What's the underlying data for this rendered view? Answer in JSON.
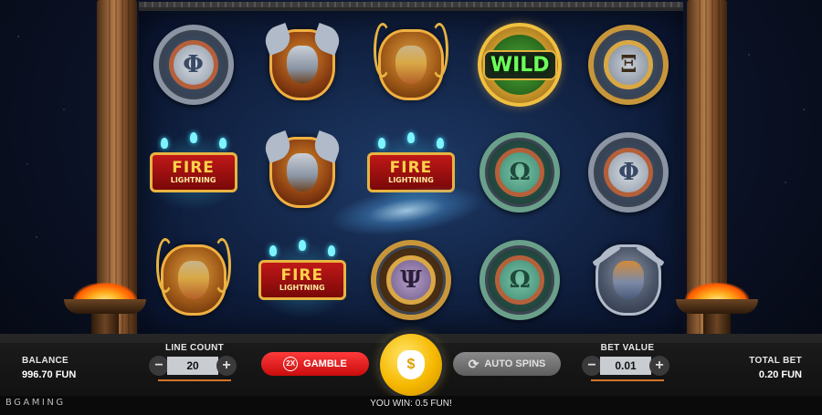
{
  "brand": "BGAMING",
  "balance": {
    "label": "BALANCE",
    "value": "996.70 FUN"
  },
  "total_bet": {
    "label": "TOTAL BET",
    "value": "0.20 FUN"
  },
  "line_count": {
    "label": "LINE COUNT",
    "value": "20",
    "minus": "−",
    "plus": "+"
  },
  "bet_value": {
    "label": "BET VALUE",
    "value": "0.01",
    "minus": "−",
    "plus": "+"
  },
  "gamble": {
    "badge": "2X",
    "label": "GAMBLE"
  },
  "spin": {
    "icon": "money-bag-icon",
    "glyph": "$"
  },
  "auto_spins": {
    "icon": "refresh-icon",
    "label": "AUTO SPINS"
  },
  "win_message": "YOU WIN: 0.5 FUN!",
  "reels": [
    [
      "shield-phi",
      "warrior-axes",
      "god-wreath",
      "wild",
      "shield-sigma"
    ],
    [
      "fire-lightning",
      "warrior-axes",
      "fire-lightning",
      "shield-omega",
      "shield-phi"
    ],
    [
      "god-wreath",
      "fire-lightning",
      "shield-psi",
      "shield-omega",
      "zeus-swords"
    ]
  ],
  "symbols": {
    "phi": "Φ",
    "sigma": "Ξ",
    "omega": "Ω",
    "psi": "Ψ",
    "wild": "WILD",
    "fire_line1": "FIRE",
    "fire_line2": "LIGHTNING"
  },
  "colors": {
    "gamble": "#e81818",
    "spin": "#f6b800",
    "autospins": "#6e6e6e",
    "accent": "#d4742a"
  }
}
